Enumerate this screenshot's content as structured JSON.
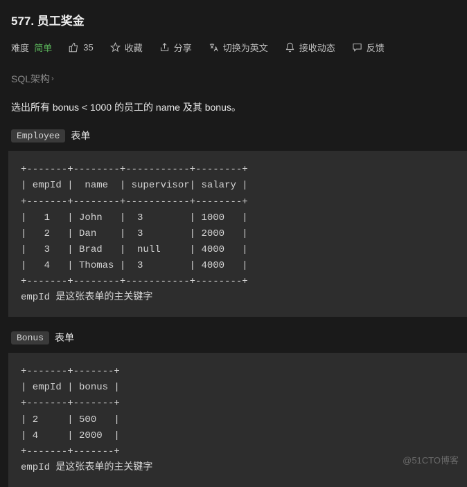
{
  "title": "577. 员工奖金",
  "meta": {
    "difficulty_label": "难度",
    "difficulty_value": "简单",
    "likes": "35",
    "favorite": "收藏",
    "share": "分享",
    "translate": "切换为英文",
    "subscribe": "接收动态",
    "feedback": "反馈"
  },
  "sql_schema": "SQL架构",
  "description": "选出所有 bonus < 1000 的员工的 name 及其 bonus。",
  "tables": [
    {
      "name": "Employee",
      "suffix": "表单",
      "ascii": "+-------+--------+-----------+--------+\n| empId |  name  | supervisor| salary |\n+-------+--------+-----------+--------+\n|   1   | John   |  3        | 1000   |\n|   2   | Dan    |  3        | 2000   |\n|   3   | Brad   |  null     | 4000   |\n|   4   | Thomas |  3        | 4000   |\n+-------+--------+-----------+--------+\nempId 是这张表单的主关键字"
    },
    {
      "name": "Bonus",
      "suffix": "表单",
      "ascii": "+-------+-------+\n| empId | bonus |\n+-------+-------+\n| 2     | 500   |\n| 4     | 2000  |\n+-------+-------+\nempId 是这张表单的主关键字"
    }
  ],
  "watermark": "@51CTO博客",
  "chart_data": {
    "type": "table",
    "tables": [
      {
        "name": "Employee",
        "columns": [
          "empId",
          "name",
          "supervisor",
          "salary"
        ],
        "rows": [
          [
            1,
            "John",
            3,
            1000
          ],
          [
            2,
            "Dan",
            3,
            2000
          ],
          [
            3,
            "Brad",
            null,
            4000
          ],
          [
            4,
            "Thomas",
            3,
            4000
          ]
        ],
        "primary_key": "empId"
      },
      {
        "name": "Bonus",
        "columns": [
          "empId",
          "bonus"
        ],
        "rows": [
          [
            2,
            500
          ],
          [
            4,
            2000
          ]
        ],
        "primary_key": "empId"
      }
    ]
  }
}
